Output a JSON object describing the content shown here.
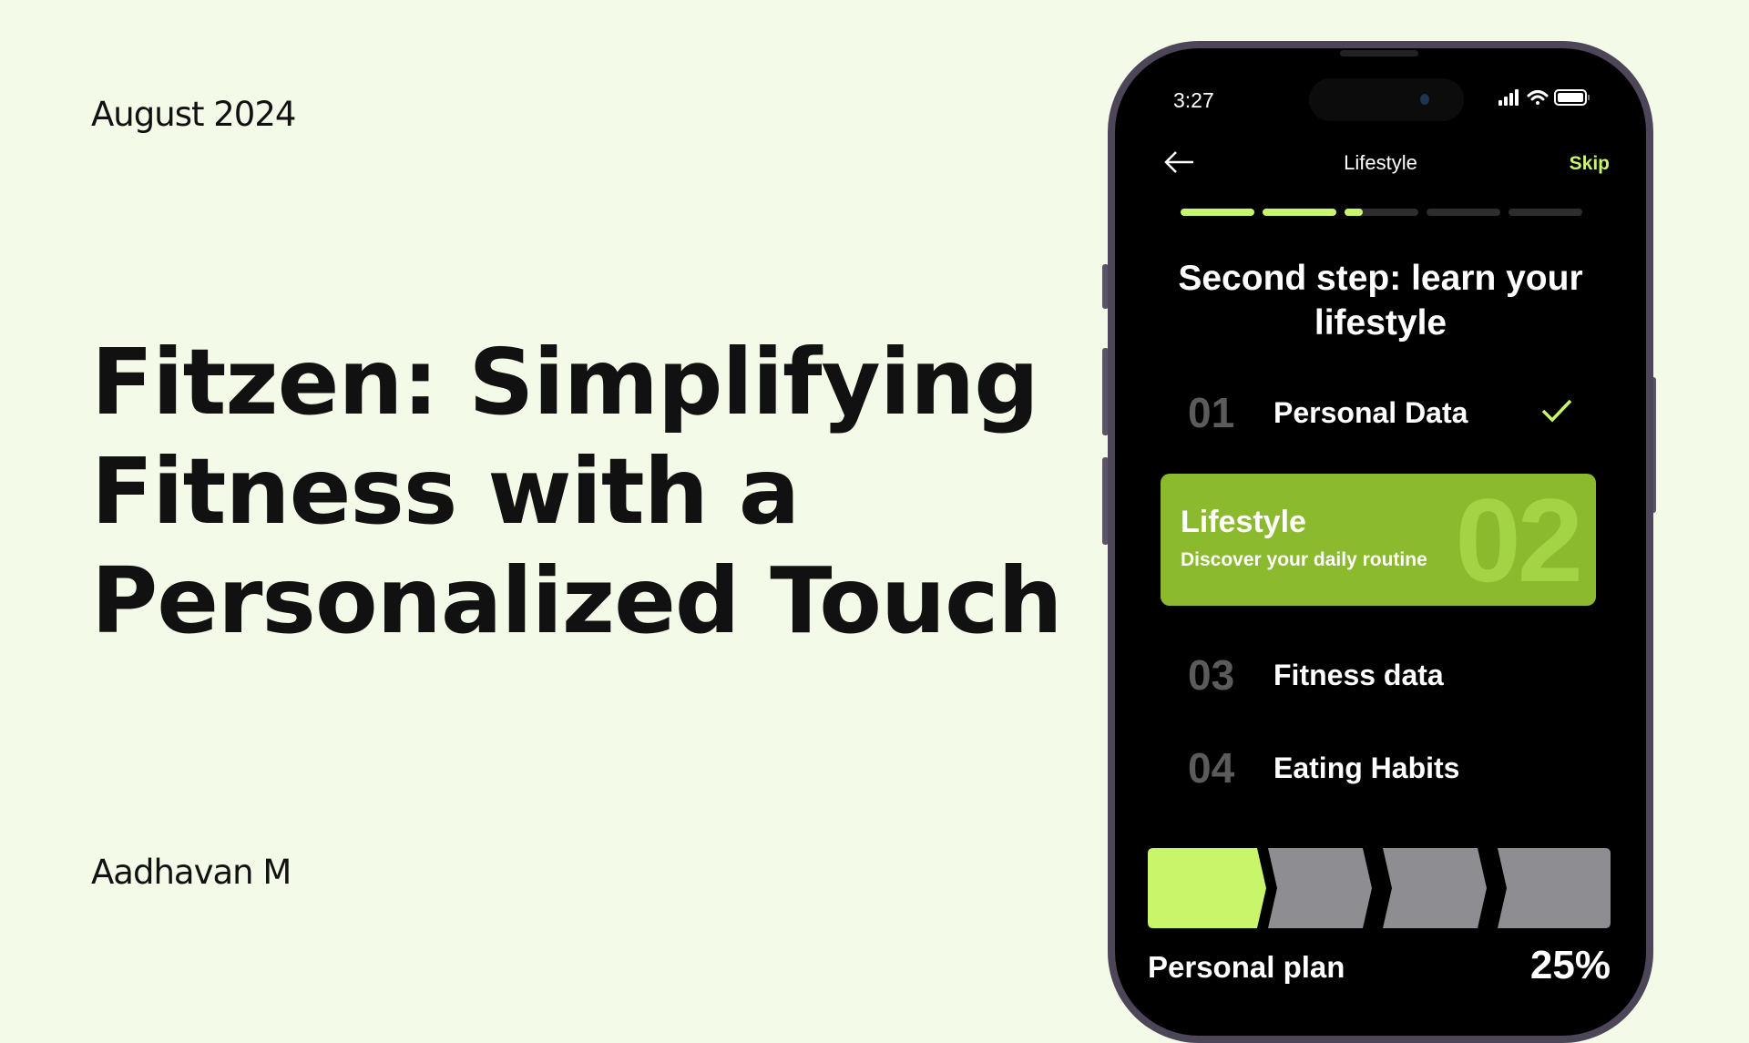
{
  "slide": {
    "date": "August 2024",
    "title_lines": [
      "Fitzen: Simplifying",
      "Fitness with a",
      "Personalized Touch"
    ],
    "author": "Aadhavan M"
  },
  "phone": {
    "status": {
      "time": "3:27"
    },
    "nav": {
      "title": "Lifestyle",
      "skip": "Skip"
    },
    "progress": {
      "segments": 5,
      "completed": 2,
      "current_fraction": 0.25
    },
    "heading_lines": [
      "Second step: learn your",
      "lifestyle"
    ],
    "steps": [
      {
        "num": "01",
        "label": "Personal Data",
        "done": true
      },
      {
        "num": "02",
        "label": "Lifestyle",
        "subtitle": "Discover your daily routine",
        "active": true
      },
      {
        "num": "03",
        "label": "Fitness data"
      },
      {
        "num": "04",
        "label": "Eating Habits"
      }
    ],
    "plan": {
      "label": "Personal plan",
      "percent": "25%",
      "steps_total": 4,
      "steps_done": 1
    },
    "colors": {
      "accent": "#c8f56a",
      "card": "#8cba2f",
      "inactive": "#8e8e92"
    }
  }
}
